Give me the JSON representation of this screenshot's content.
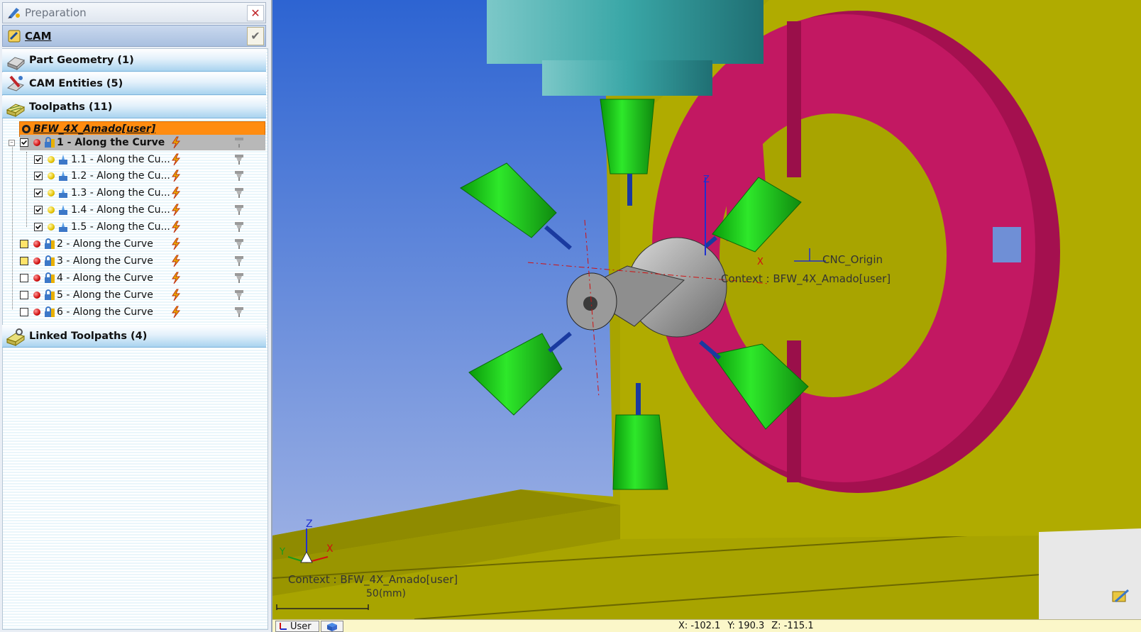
{
  "panel": {
    "title": "Preparation",
    "close_glyph": "✕",
    "mode_label": "CAM",
    "validate_glyph": "✔"
  },
  "sections": {
    "part_geometry": "Part Geometry (1)",
    "cam_entities": "CAM Entities (5)",
    "toolpaths": "Toolpaths (11)",
    "linked_toolpaths": "Linked Toolpaths (4)"
  },
  "context_label": "BFW_4X_Amado[user]",
  "toolpaths": [
    {
      "label": "1 - Along the Curve",
      "checked": true,
      "status": "red",
      "selected": true
    },
    {
      "label": "1.1 - Along the Cu...",
      "checked": true,
      "status": "yellow"
    },
    {
      "label": "1.2 - Along the Cu...",
      "checked": true,
      "status": "yellow"
    },
    {
      "label": "1.3 - Along the Cu...",
      "checked": true,
      "status": "yellow"
    },
    {
      "label": "1.4 - Along the Cu...",
      "checked": true,
      "status": "yellow"
    },
    {
      "label": "1.5 - Along the Cu...",
      "checked": true,
      "status": "yellow"
    },
    {
      "label": "2 - Along the Curve",
      "checked": false,
      "box": "yellow",
      "status": "red"
    },
    {
      "label": "3 - Along the Curve",
      "checked": false,
      "box": "yellow",
      "status": "red"
    },
    {
      "label": "4 - Along the Curve",
      "checked": false,
      "status": "red"
    },
    {
      "label": "5 - Along the Curve",
      "checked": false,
      "status": "red"
    },
    {
      "label": "6 - Along the Curve",
      "checked": false,
      "status": "red"
    }
  ],
  "viewport": {
    "cnc_origin_label": "CNC_Origin",
    "context_text_upper": "Context : BFW_4X_Amado[user]",
    "context_text_lower": "Context : BFW_4X_Amado[user]",
    "scale_label": "50(mm)",
    "axis_z": "Z",
    "axis_y": "Y",
    "axis_x": "X",
    "colors": {
      "sky_top": "#2d64d2",
      "sky_bottom": "#a9b9e6",
      "machine_body": "#a8a400",
      "fixture": "#c21862",
      "tool_holder": "#1fcf10",
      "spindle": "#3aa7a7"
    }
  },
  "status": {
    "user_label": "User",
    "x": "X: -102.1",
    "y": "Y: 190.3",
    "z": "Z: -115.1"
  }
}
